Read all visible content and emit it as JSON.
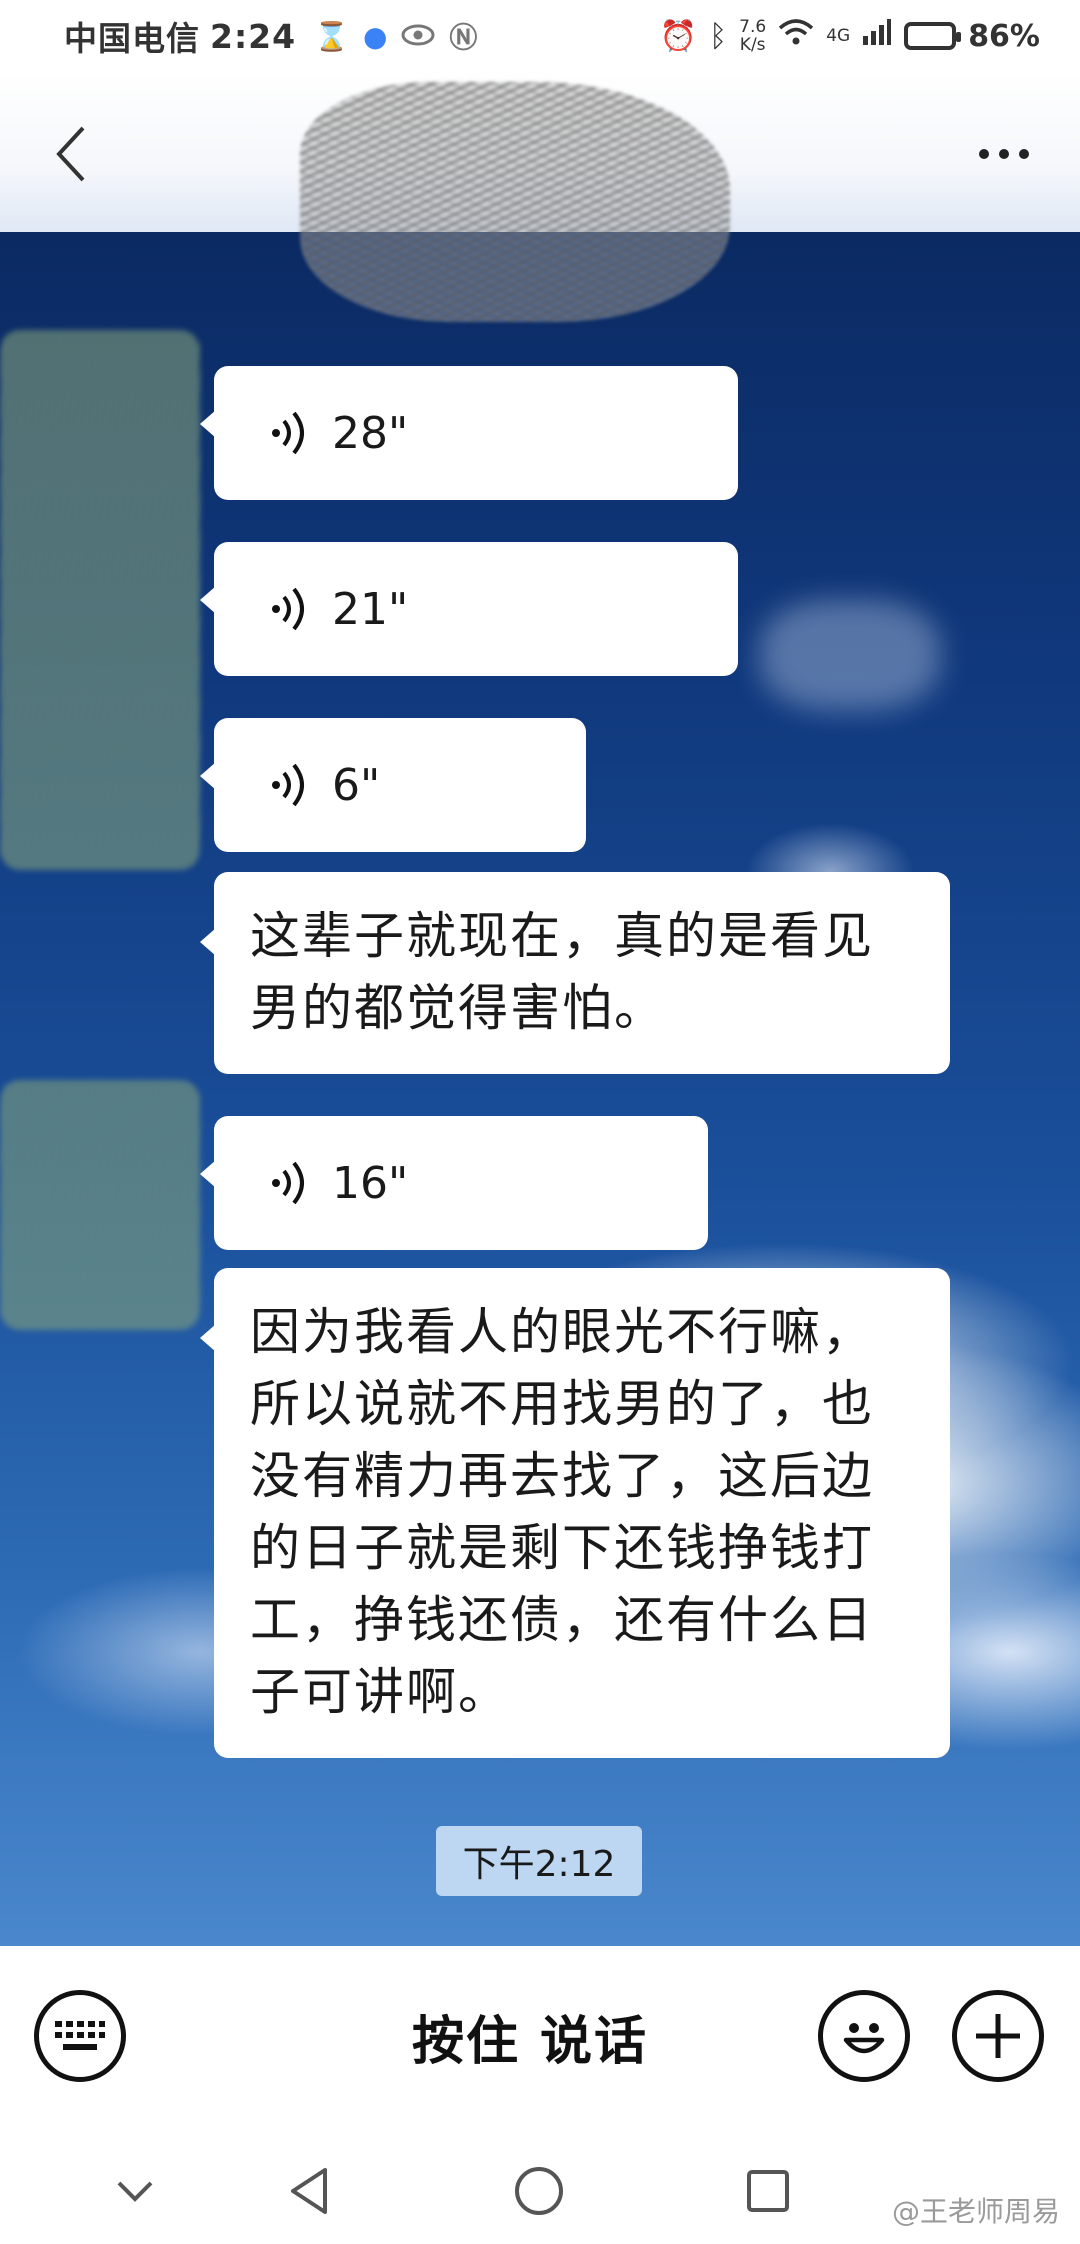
{
  "status_bar": {
    "carrier": "中国电信",
    "time": "2:24",
    "network_speed_value": "7.6",
    "network_speed_unit": "K/s",
    "signal_type": "4G",
    "battery": "86%",
    "battery_level": 0.86
  },
  "messages": [
    {
      "type": "voice",
      "duration": "28\""
    },
    {
      "type": "voice",
      "duration": "21\""
    },
    {
      "type": "voice",
      "duration": "6\""
    },
    {
      "type": "text",
      "lines": [
        "这辈子就现在，真的是看见",
        "男的都觉得害怕。"
      ]
    },
    {
      "type": "voice",
      "duration": "16\""
    },
    {
      "type": "text",
      "lines": [
        "因为我看人的眼光不行嘛，",
        "所以说就不用找男的了，也",
        "没有精力再去找了，这后边",
        "的日子就是剩下还钱挣钱打",
        "工，挣钱还债，还有什么日",
        "子可讲啊。"
      ]
    }
  ],
  "timestamp": "下午2:12",
  "input_bar": {
    "hold_to_talk": "按住 说话"
  },
  "icons": {
    "back": "chevron-left-icon",
    "more": "more-dots-icon",
    "keyboard": "keyboard-icon",
    "emoji": "smiley-icon",
    "add": "plus-icon",
    "voice": "voice-wave-icon"
  },
  "watermark": "@王老师周易",
  "colors": {
    "bubble": "#ffffff",
    "sky_dark": "#0b2a63",
    "sky_light": "#4a87cc",
    "timestamp_bg": "#c8def5"
  }
}
